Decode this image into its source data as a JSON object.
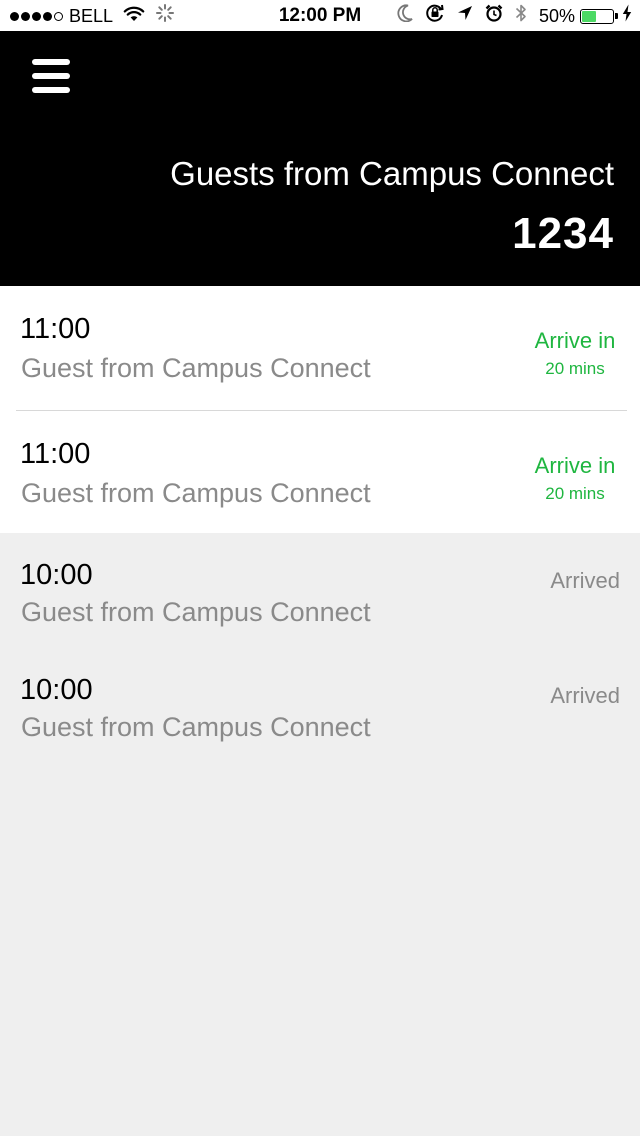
{
  "status_bar": {
    "carrier": "BELL",
    "time": "12:00 PM",
    "battery_percent": "50%",
    "battery_level": 0.5,
    "icons": [
      "signal-dots",
      "wifi-icon",
      "activity-spinner-icon",
      "moon-icon",
      "orientation-lock-icon",
      "location-arrow-icon",
      "alarm-icon",
      "bluetooth-icon",
      "battery-icon",
      "charging-bolt-icon"
    ]
  },
  "header": {
    "menu_icon": "hamburger-menu-icon",
    "title": "Guests from Campus Connect",
    "count": "1234"
  },
  "guests": [
    {
      "time": "11:00",
      "subtitle": "Guest from Campus Connect",
      "status_main": "Arrive in",
      "status_sub": "20 mins",
      "state": "upcoming"
    },
    {
      "time": "11:00",
      "subtitle": "Guest from Campus Connect",
      "status_main": "Arrive in",
      "status_sub": "20 mins",
      "state": "upcoming"
    },
    {
      "time": "10:00",
      "subtitle": "Guest from Campus Connect",
      "status_main": "Arrived",
      "state": "arrived"
    },
    {
      "time": "10:00",
      "subtitle": "Guest from Campus Connect",
      "status_main": "Arrived",
      "state": "arrived"
    }
  ],
  "colors": {
    "header_background": "#000000",
    "upcoming_status": "#1fb640",
    "arrived_status": "#8a8a8a",
    "arrived_background": "#efefef",
    "battery_fill": "#4cd964"
  }
}
